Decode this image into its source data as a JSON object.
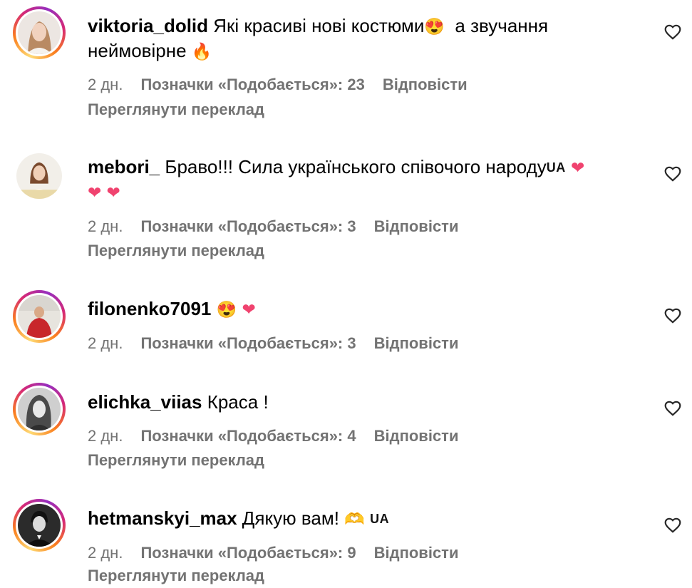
{
  "comments": [
    {
      "username": "viktoria_dolid",
      "text_part1": "Які красиві нові костюми",
      "emoji1": "😍",
      "text_part2": "  а звучання",
      "text_line2": "неймовірне",
      "emoji2": "🔥",
      "time": "2 дн.",
      "likes": "Позначки «Подобається»: 23",
      "reply": "Відповісти",
      "translate": "Переглянути переклад",
      "avatar_icon": "avatar-icon",
      "like_icon": "heart-outline-icon"
    },
    {
      "username": "mebori_",
      "text_part1": "Браво!!! Сила українського співочого народу",
      "flag": "UA",
      "emoji1": "❤",
      "emoji2": "❤",
      "emoji3": "❤",
      "time": "2 дн.",
      "likes": "Позначки «Подобається»: 3",
      "reply": "Відповісти",
      "translate": "Переглянути переклад",
      "avatar_icon": "avatar-icon",
      "like_icon": "heart-outline-icon"
    },
    {
      "username": "filonenko7091",
      "emoji1": "😍",
      "emoji2": "❤",
      "time": "2 дн.",
      "likes": "Позначки «Подобається»: 3",
      "reply": "Відповісти",
      "avatar_icon": "avatar-icon",
      "like_icon": "heart-outline-icon"
    },
    {
      "username": "elichka_viias",
      "text_part1": "Краса !",
      "time": "2 дн.",
      "likes": "Позначки «Подобається»: 4",
      "reply": "Відповісти",
      "translate": "Переглянути переклад",
      "avatar_icon": "avatar-icon",
      "like_icon": "heart-outline-icon"
    },
    {
      "username": "hetmanskyi_max",
      "text_part1": "Дякую вам!",
      "emoji1": "🫶",
      "flag": "UA",
      "time": "2 дн.",
      "likes": "Позначки «Подобається»: 9",
      "reply": "Відповісти",
      "translate": "Переглянути переклад",
      "avatar_icon": "avatar-icon",
      "like_icon": "heart-outline-icon"
    }
  ],
  "colors": {
    "text": "#000000",
    "secondary": "#737373",
    "heart_emoji": "#f0436f",
    "story_ring_start": "#feda75",
    "story_ring_end": "#962fbf"
  }
}
